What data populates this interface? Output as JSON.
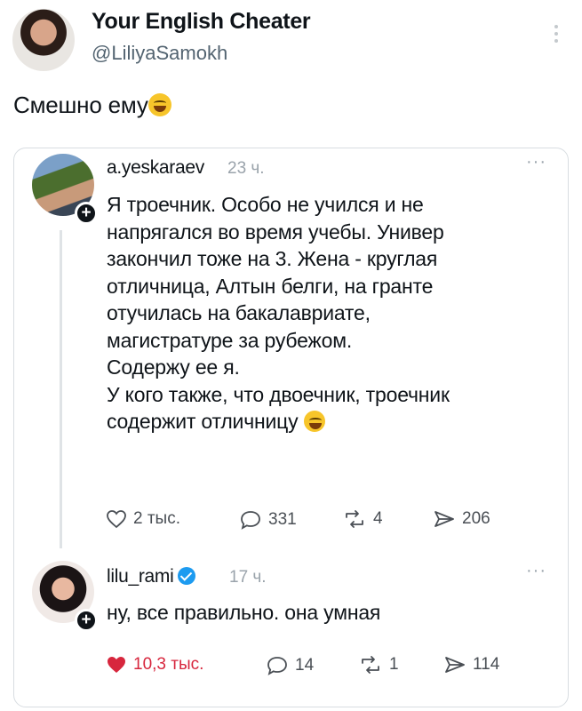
{
  "tweet": {
    "author_name": "Your English Cheater",
    "author_handle": "@LiliyaSamokh",
    "text": "Смешно ему",
    "text_emoji": "face-with-tears-of-joy"
  },
  "quoted": {
    "post": {
      "username": "a.yeskaraev",
      "time": "23 ч.",
      "lines": [
        "Я троечник. Особо не учился и не",
        "напрягался во время учебы. Универ",
        "закончил тоже на 3. Жена - круглая",
        "отличница, Алтын белги, на гранте",
        "отучилась на бакалавриате,",
        "магистратуре за рубежом.",
        "Содержу ее я.",
        "У кого также, что двоечник, троечник",
        "содержит отличницу"
      ],
      "stats": {
        "likes": "2 тыс.",
        "comments": "331",
        "reposts": "4",
        "shares": "206"
      }
    },
    "reply": {
      "username": "lilu_rami",
      "time": "17 ч.",
      "text": "ну, все правильно. она умная",
      "stats": {
        "likes": "10,3 тыс.",
        "comments": "14",
        "reposts": "1",
        "shares": "114"
      },
      "like_color": "#d7263d"
    },
    "menu_glyph": "···"
  }
}
